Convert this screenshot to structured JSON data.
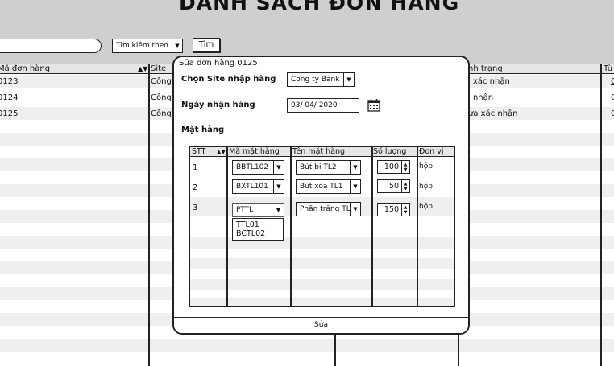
{
  "page": {
    "title": "DANH SÁCH ĐƠN HÀNG",
    "search": {
      "value": ""
    },
    "search_by_label": "Tìm kiếm theo",
    "search_button": "Tìm"
  },
  "table": {
    "headers": [
      "Mã đơn hàng",
      "Site",
      "nh trạng",
      "Tù"
    ],
    "rows": [
      {
        "code": "0123",
        "site": "Công",
        "status": "i xác nhận",
        "action": "C"
      },
      {
        "code": "0124",
        "site": "Công",
        "status": "i nhận",
        "action": "C"
      },
      {
        "code": "0125",
        "site": "Công",
        "status": "ưa xác nhận",
        "action": "C"
      }
    ]
  },
  "modal": {
    "title": "Sửa đơn hàng 0125",
    "site_label": "Chọn Site nhập hàng",
    "site_value": "Công ty Bank",
    "date_label": "Ngày nhận hàng",
    "date_value": "03/ 04/ 2020",
    "items_label": "Mặt hàng",
    "grid_headers": [
      "STT",
      "Mã mặt hàng",
      "Tên mặt hàng",
      "Số lượng",
      "Đơn vị"
    ],
    "items": [
      {
        "stt": "1",
        "code": "BBTL102",
        "name": "Bút bi TL2",
        "qty": "100",
        "unit": "hộp"
      },
      {
        "stt": "2",
        "code": "BXTL101",
        "name": "Bút xóa TL1",
        "qty": "50",
        "unit": "hộp"
      },
      {
        "stt": "3",
        "code": "PTTL",
        "name": "Phấn trắng TL",
        "qty": "150",
        "unit": "hộp"
      }
    ],
    "code_dropdown_options": [
      "TTL01",
      "BCTL02"
    ],
    "save_button": "Sửa"
  },
  "icons": {
    "calendar": "calendar-icon",
    "sort": "sort-icon",
    "dropdown": "chevron-down-icon",
    "spinner": "spinner-icon"
  },
  "colors": {
    "background": "#cfcfcf",
    "stripe": "#efefef",
    "border": "#222222"
  }
}
